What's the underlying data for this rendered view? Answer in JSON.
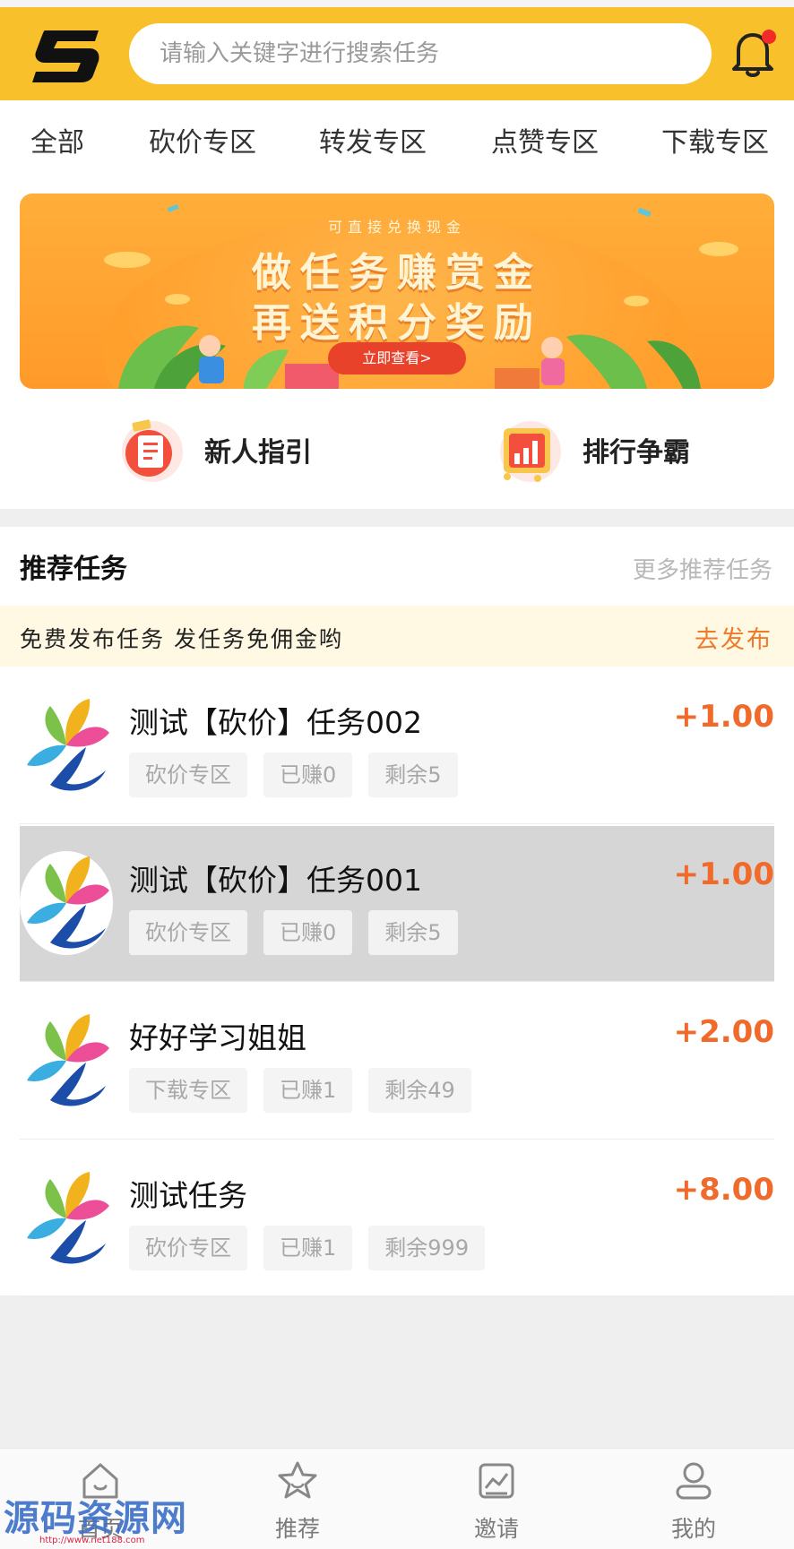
{
  "header": {
    "search_placeholder": "请输入关键字进行搜索任务",
    "has_notification": true
  },
  "tabs": [
    {
      "label": "全部",
      "active": true
    },
    {
      "label": "砍价专区",
      "active": false
    },
    {
      "label": "转发专区",
      "active": false
    },
    {
      "label": "点赞专区",
      "active": false
    },
    {
      "label": "下载专区",
      "active": false
    }
  ],
  "banner": {
    "small_text": "可直接兑换现金",
    "line1": "做任务赚赏金",
    "line2": "再送积分奖励",
    "button": "立即查看>"
  },
  "shortcuts": [
    {
      "label": "新人指引",
      "icon": "document-icon"
    },
    {
      "label": "排行争霸",
      "icon": "ranking-chart-icon"
    }
  ],
  "recommend": {
    "title": "推荐任务",
    "more": "更多推荐任务"
  },
  "notice": {
    "text": "免费发布任务 发任务免佣金哟",
    "action": "去发布"
  },
  "tasks": [
    {
      "name": "测试【砍价】任务002",
      "reward": "+1.00",
      "tags": [
        "砍价专区",
        "已赚0",
        "剩余5"
      ]
    },
    {
      "name": "测试【砍价】任务001",
      "reward": "+1.00",
      "tags": [
        "砍价专区",
        "已赚0",
        "剩余5"
      ]
    },
    {
      "name": "好好学习姐姐",
      "reward": "+2.00",
      "tags": [
        "下载专区",
        "已赚1",
        "剩余49"
      ]
    },
    {
      "name": "测试任务",
      "reward": "+8.00",
      "tags": [
        "砍价专区",
        "已赚1",
        "剩余999"
      ]
    }
  ],
  "nav": [
    {
      "label": "首页",
      "icon": "home-icon"
    },
    {
      "label": "推荐",
      "icon": "star-icon"
    },
    {
      "label": "邀请",
      "icon": "chart-icon"
    },
    {
      "label": "我的",
      "icon": "user-icon"
    }
  ],
  "watermark": {
    "text": "源码资源网",
    "url": "http://www.net188.com"
  },
  "colors": {
    "header_bg": "#f8c12c",
    "accent_orange": "#ef6a2b",
    "notice_bg": "#fff8e3"
  }
}
